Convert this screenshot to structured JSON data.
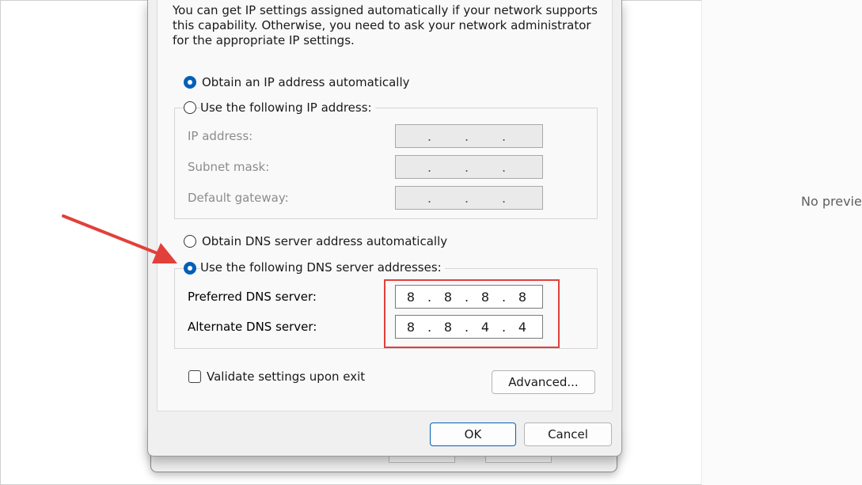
{
  "right_panel": {
    "no_preview_text": "No previe"
  },
  "dialog": {
    "description": [
      "You can get IP settings assigned automatically if your network supports",
      "this capability. Otherwise, you need to ask your network administrator",
      "for the appropriate IP settings."
    ],
    "ip_options": {
      "auto_label": "Obtain an IP address automatically",
      "auto_selected": true,
      "manual_label": "Use the following IP address:",
      "manual_selected": false
    },
    "ip_fields": {
      "ip_address_label": "IP address:",
      "subnet_mask_label": "Subnet mask:",
      "default_gateway_label": "Default gateway:"
    },
    "dns_options": {
      "auto_label": "Obtain DNS server address automatically",
      "auto_selected": false,
      "manual_label": "Use the following DNS server addresses:",
      "manual_selected": true
    },
    "dns_fields": {
      "preferred_label": "Preferred DNS server:",
      "preferred_value": [
        "8",
        "8",
        "8",
        "8"
      ],
      "alternate_label": "Alternate DNS server:",
      "alternate_value": [
        "8",
        "8",
        "4",
        "4"
      ]
    },
    "validate_label": "Validate settings upon exit",
    "validate_checked": false,
    "advanced_label": "Advanced...",
    "ok_label": "OK",
    "cancel_label": "Cancel"
  },
  "colors": {
    "accent": "#0060b8",
    "annotation": "#e2403b"
  }
}
